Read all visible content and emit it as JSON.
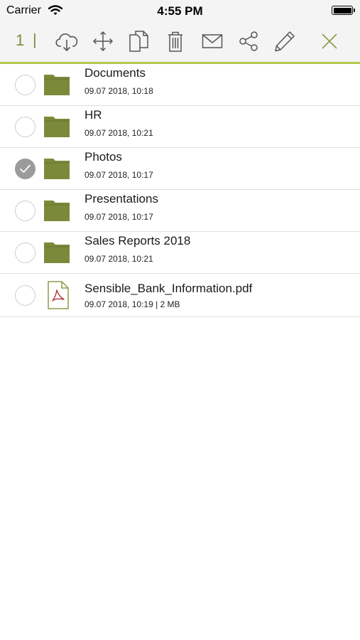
{
  "status_bar": {
    "carrier": "Carrier",
    "time": "4:55 PM"
  },
  "toolbar": {
    "selected_count": "1",
    "separator": "|",
    "icons": [
      "cloud-download-icon",
      "move-icon",
      "copy-icon",
      "delete-icon",
      "mail-icon",
      "share-icon",
      "rename-pencil-icon",
      "close-icon"
    ]
  },
  "colors": {
    "accent": "#7d8a34",
    "folder": "#7b8a3a",
    "toolbar_border": "#b4c84a",
    "checked": "#9b9b9b"
  },
  "files": [
    {
      "name": "Documents",
      "meta": "09.07 2018, 10:18",
      "type": "folder",
      "selected": false
    },
    {
      "name": "HR",
      "meta": "09.07 2018, 10:21",
      "type": "folder",
      "selected": false
    },
    {
      "name": "Photos",
      "meta": "09.07 2018, 10:17",
      "type": "folder",
      "selected": true
    },
    {
      "name": "Presentations",
      "meta": "09.07 2018, 10:17",
      "type": "folder",
      "selected": false
    },
    {
      "name": "Sales Reports 2018",
      "meta": "09.07 2018, 10:21",
      "type": "folder",
      "selected": false
    },
    {
      "name": "Sensible_Bank_Information.pdf",
      "meta": "09.07 2018, 10:19 | 2 MB",
      "type": "pdf",
      "selected": false
    }
  ]
}
